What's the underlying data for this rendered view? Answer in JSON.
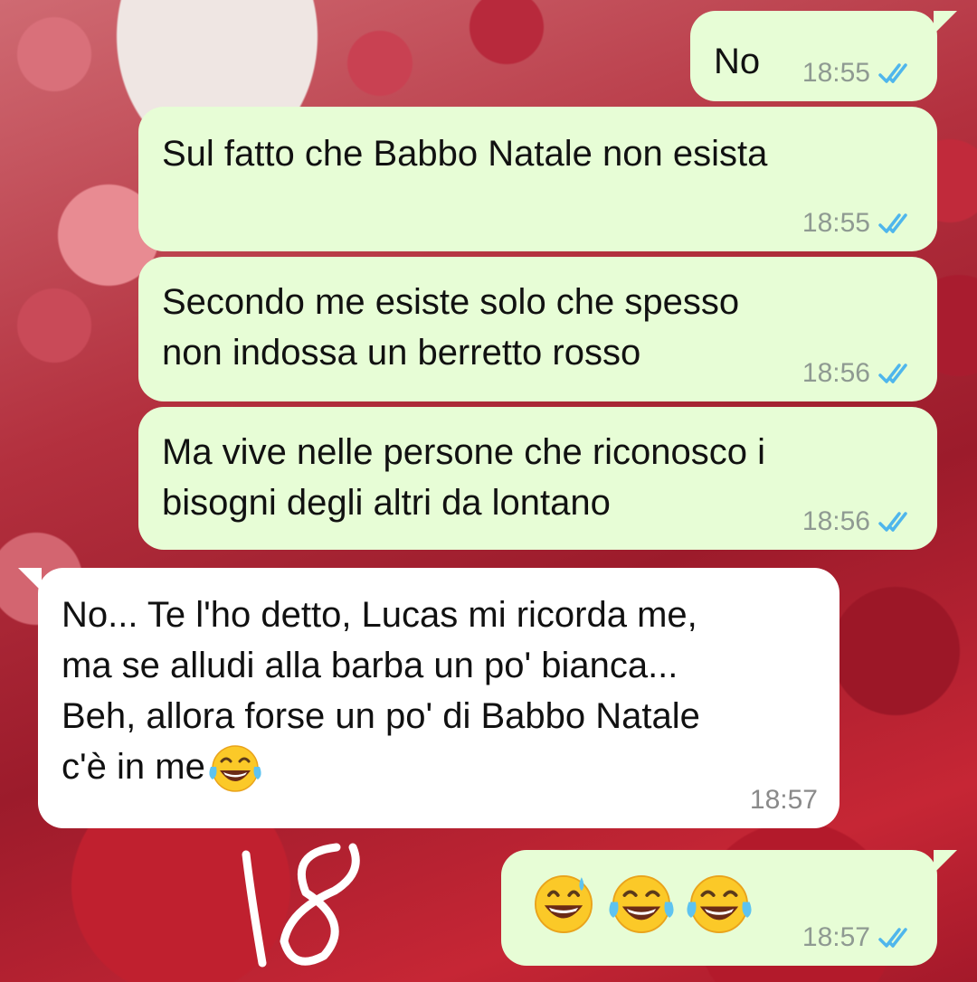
{
  "chat": {
    "messages": [
      {
        "direction": "outgoing",
        "text": "No",
        "time": "18:55",
        "status": "read"
      },
      {
        "direction": "outgoing",
        "text": "Sul fatto che Babbo Natale non esista",
        "time": "18:55",
        "status": "read"
      },
      {
        "direction": "outgoing",
        "text_lines": [
          "Secondo me esiste solo che spesso",
          "non indossa un berretto rosso"
        ],
        "time": "18:56",
        "status": "read"
      },
      {
        "direction": "outgoing",
        "text_lines": [
          "Ma vive nelle persone che riconosco i",
          "bisogni degli altri da lontano"
        ],
        "time": "18:56",
        "status": "read"
      },
      {
        "direction": "incoming",
        "text_lines": [
          "No... Te l'ho detto, Lucas mi ricorda me,",
          "ma se alludi alla barba un po' bianca...",
          "Beh, allora forse un po' di Babbo Natale",
          "c'è in me"
        ],
        "emoji": [
          "face-with-tears-of-joy-icon"
        ],
        "time": "18:57"
      },
      {
        "direction": "outgoing",
        "emoji": [
          "grinning-face-with-sweat-icon",
          "face-with-tears-of-joy-icon",
          "face-with-tears-of-joy-icon"
        ],
        "time": "18:57",
        "status": "read"
      }
    ]
  },
  "overlay": {
    "handwritten_text": "18"
  },
  "colors": {
    "outgoing_bubble": "#e7fdd6",
    "incoming_bubble": "#ffffff",
    "read_ticks": "#4fb6ec",
    "timestamp": "#8f9a92"
  }
}
